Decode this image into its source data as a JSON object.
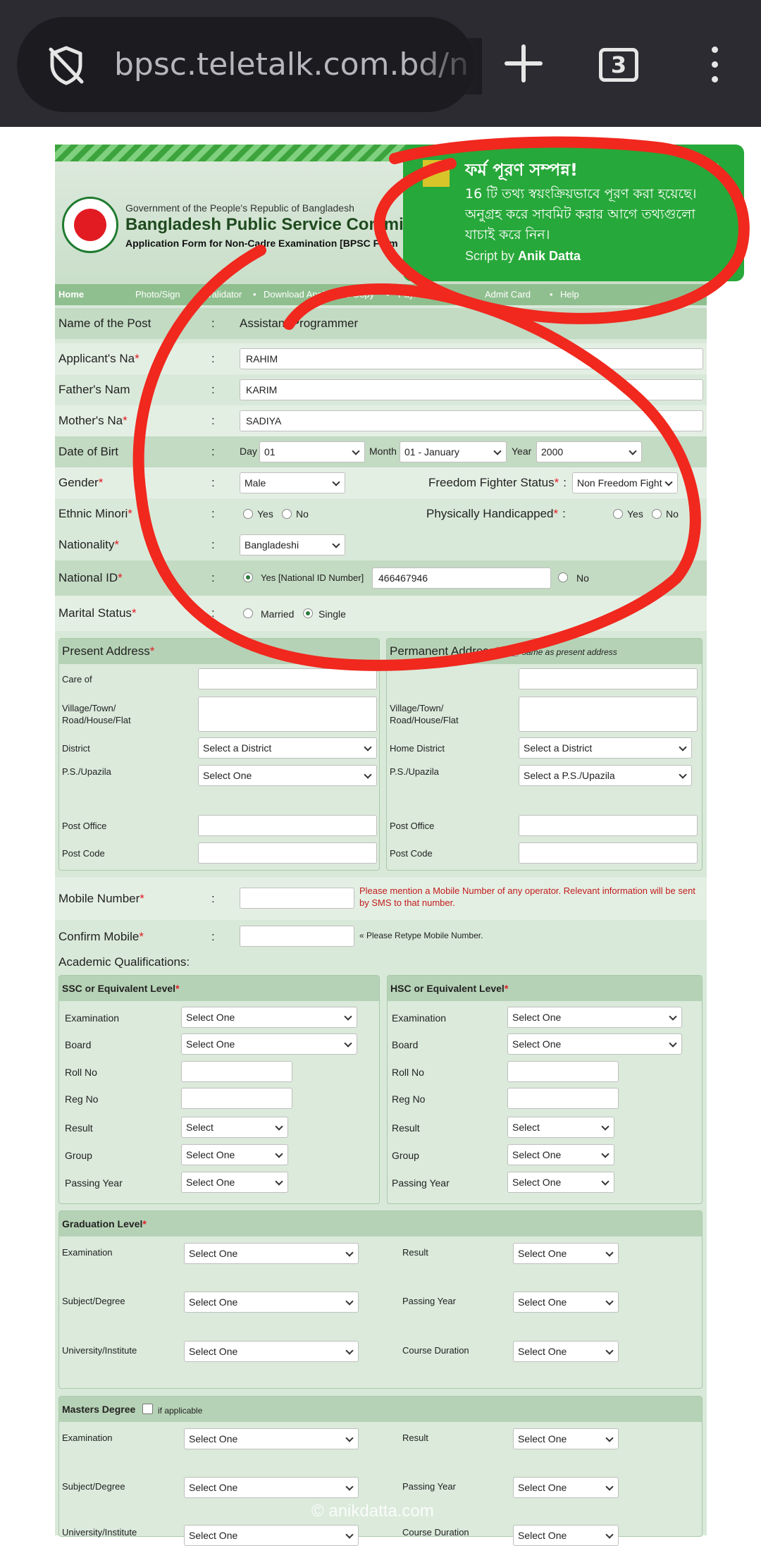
{
  "browser": {
    "url": "bpsc.teletalk.com.bd/nc",
    "tab_count": "3"
  },
  "banner": {
    "govt": "Government of the People's Republic of Bangladesh",
    "commission": "Bangladesh Public Service Commi",
    "form_title": "Application Form for Non-Cadre Examination [BPSC Form"
  },
  "nav": {
    "home": "Home",
    "photo": "Photo/Sign",
    "validator": "Validator",
    "download": "Download Applicant's Copy",
    "payment": "Payment",
    "admit": "Admit Card",
    "help": "Help",
    "dot": "•"
  },
  "personal": {
    "post_label": "Name of  the Post",
    "post_value": "Assistant Programmer",
    "applicant_label": "Applicant's Na",
    "applicant_value": "RAHIM",
    "father_label": "Father's Nam",
    "father_value": "KARIM",
    "mother_label": "Mother's Na",
    "mother_value": "SADIYA",
    "dob_label": "Date of Birt",
    "day_label": "Day",
    "day_value": "01",
    "month_label": "Month",
    "month_value": "01 - January",
    "year_label": "Year",
    "year_value": "2000",
    "gender_label": "Gender",
    "gender_value": "Male",
    "ff_label": "Freedom Fighter Status",
    "ff_value": "Non Freedom Fight",
    "ethnic_label": "Ethnic Minori",
    "yes": "Yes",
    "no": "No",
    "handicap_label": "Physically Handicapped",
    "nationality_label": "Nationality",
    "nationality_value": "Bangladeshi",
    "nid_label": "National ID",
    "nid_yes": "Yes [National ID Number]",
    "nid_value": "466467946",
    "marital_label": "Marital Status",
    "married": "Married",
    "single": "Single",
    "colon": ":",
    "req": "*"
  },
  "address": {
    "present_title": "Present Address",
    "permanent_title": "Permanent Address",
    "same_as": "same as present address",
    "care_of": "Care of",
    "village": "Village/Town/",
    "village2": "Road/House/Flat",
    "district": "District",
    "home_district": "Home District",
    "select_district": "Select a District",
    "ps_upazila": "P.S./Upazila",
    "select_one": "Select One",
    "select_ps": "Select a P.S./Upazila",
    "post_office": "Post Office",
    "post_code": "Post Code"
  },
  "mobile": {
    "label": "Mobile Number",
    "hint": "Please mention a Mobile Number of any operator. Relevant information will be sent by SMS to that number.",
    "confirm_label": "Confirm Mobile",
    "confirm_hint": "« Please Retype Mobile Number."
  },
  "academic": {
    "title": "Academic Qualifications:",
    "ssc_title": "SSC or Equivalent Level",
    "hsc_title": "HSC or Equivalent Level",
    "examination": "Examination",
    "board": "Board",
    "roll": "Roll No",
    "reg": "Reg No",
    "result": "Result",
    "group": "Group",
    "passing_year": "Passing Year",
    "select_one": "Select One",
    "select": "Select",
    "grad_title": "Graduation Level",
    "subject": "Subject/Degree",
    "university": "University/Institute",
    "course_duration": "Course Duration",
    "masters_title": "Masters Degree",
    "if_applicable": "if applicable"
  },
  "toast": {
    "title": "ফর্ম পূরণ সম্পন্ন!",
    "message": "16 টি তথ্য স্বয়ংক্রিয়ভাবে পূরণ করা হয়েছে। অনুগ্রহ করে সাবমিট করার আগে তথ্যগুলো যাচাই করে নিন।",
    "script_by": "Script by",
    "author": "Anik Datta",
    "close": "×"
  },
  "watermark": "© anikdatta.com",
  "colors": {
    "toast": "#27a83a",
    "annotation": "#f0281e",
    "page_bg": "#d9e9d9"
  }
}
